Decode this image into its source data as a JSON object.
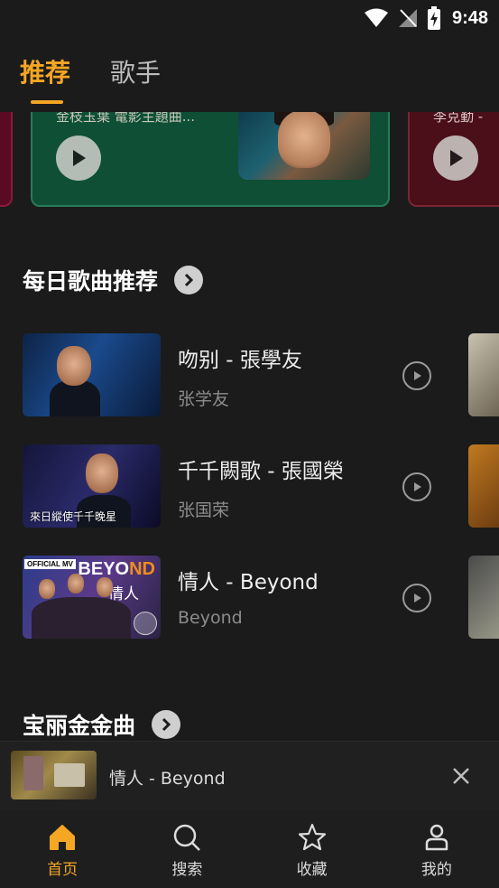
{
  "status_bar": {
    "time": "9:48"
  },
  "top_tabs": [
    {
      "label": "推荐",
      "active": true
    },
    {
      "label": "歌手",
      "active": false
    }
  ],
  "banners": {
    "main_text": "金枝玉葉 電影主題曲...",
    "right_text": "李克勤 -"
  },
  "section_daily": {
    "title": "每日歌曲推荐"
  },
  "songs": [
    {
      "title": "吻别 - 張學友",
      "artist": "张学友",
      "thumb_caption": ""
    },
    {
      "title": "千千闕歌 - 張國榮",
      "artist": "张国荣",
      "thumb_caption": "來日縱使千千晚星"
    },
    {
      "title": "情人 - Beyond",
      "artist": "Beyond",
      "thumb_badge": "OFFICIAL MV",
      "thumb_logo_a": "BEYO",
      "thumb_logo_b": "ND",
      "thumb_sub": "情人"
    }
  ],
  "section_gold": {
    "title": "宝丽金金曲"
  },
  "mini_player": {
    "title": "情人 - Beyond"
  },
  "bottom_nav": [
    {
      "label": "首页",
      "icon": "home-icon",
      "active": true
    },
    {
      "label": "搜索",
      "icon": "search-icon",
      "active": false
    },
    {
      "label": "收藏",
      "icon": "star-icon",
      "active": false
    },
    {
      "label": "我的",
      "icon": "user-icon",
      "active": false
    }
  ],
  "colors": {
    "accent": "#f5a623",
    "background": "#1b1b1b"
  }
}
